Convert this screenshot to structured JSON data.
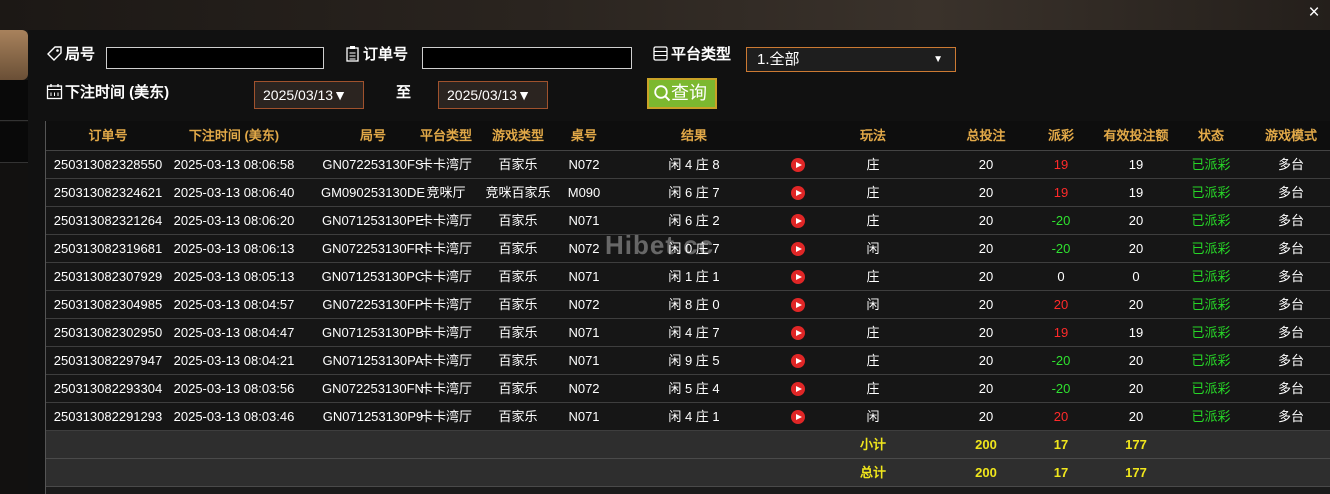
{
  "window": {
    "close_label": "×"
  },
  "filters": {
    "round_label": "局号",
    "round_value": "",
    "order_label": "订单号",
    "order_value": "",
    "platform_label": "平台类型",
    "platform_selected": "1.全部",
    "time_label": "下注时间 (美东)",
    "date_from": "2025/03/13▼",
    "to_label": "至",
    "date_to": "2025/03/13▼",
    "query_label": "查询"
  },
  "table": {
    "headers": [
      "订单号",
      "下注时间 (美东)",
      "局号",
      "平台类型",
      "游戏类型",
      "桌号",
      "结果",
      "",
      "玩法",
      "总投注",
      "派彩",
      "有效投注额",
      "状态",
      "游戏模式"
    ],
    "rows": [
      {
        "order": "250313082328550",
        "time": "2025-03-13 08:06:58",
        "round": "GN072253130FS",
        "platform": "卡卡湾厅",
        "game": "百家乐",
        "table": "N072",
        "result": "闲 4 庄 8",
        "play": "庄",
        "bet": "20",
        "payout": "19",
        "payout_sign": "pos",
        "valid": "19",
        "status": "已派彩",
        "mode": "多台"
      },
      {
        "order": "250313082324621",
        "time": "2025-03-13 08:06:40",
        "round": "GM090253130DE",
        "platform": "竞咪厅",
        "game": "竞咪百家乐",
        "table": "M090",
        "result": "闲 6 庄 7",
        "play": "庄",
        "bet": "20",
        "payout": "19",
        "payout_sign": "pos",
        "valid": "19",
        "status": "已派彩",
        "mode": "多台"
      },
      {
        "order": "250313082321264",
        "time": "2025-03-13 08:06:20",
        "round": "GN071253130PE",
        "platform": "卡卡湾厅",
        "game": "百家乐",
        "table": "N071",
        "result": "闲 6 庄 2",
        "play": "庄",
        "bet": "20",
        "payout": "-20",
        "payout_sign": "neg",
        "valid": "20",
        "status": "已派彩",
        "mode": "多台"
      },
      {
        "order": "250313082319681",
        "time": "2025-03-13 08:06:13",
        "round": "GN072253130FR",
        "platform": "卡卡湾厅",
        "game": "百家乐",
        "table": "N072",
        "result": "闲 0 庄 7",
        "play": "闲",
        "bet": "20",
        "payout": "-20",
        "payout_sign": "neg",
        "valid": "20",
        "status": "已派彩",
        "mode": "多台"
      },
      {
        "order": "250313082307929",
        "time": "2025-03-13 08:05:13",
        "round": "GN071253130PC",
        "platform": "卡卡湾厅",
        "game": "百家乐",
        "table": "N071",
        "result": "闲 1 庄 1",
        "play": "庄",
        "bet": "20",
        "payout": "0",
        "payout_sign": "zero",
        "valid": "0",
        "status": "已派彩",
        "mode": "多台"
      },
      {
        "order": "250313082304985",
        "time": "2025-03-13 08:04:57",
        "round": "GN072253130FP",
        "platform": "卡卡湾厅",
        "game": "百家乐",
        "table": "N072",
        "result": "闲 8 庄 0",
        "play": "闲",
        "bet": "20",
        "payout": "20",
        "payout_sign": "pos",
        "valid": "20",
        "status": "已派彩",
        "mode": "多台"
      },
      {
        "order": "250313082302950",
        "time": "2025-03-13 08:04:47",
        "round": "GN071253130PB",
        "platform": "卡卡湾厅",
        "game": "百家乐",
        "table": "N071",
        "result": "闲 4 庄 7",
        "play": "庄",
        "bet": "20",
        "payout": "19",
        "payout_sign": "pos",
        "valid": "19",
        "status": "已派彩",
        "mode": "多台"
      },
      {
        "order": "250313082297947",
        "time": "2025-03-13 08:04:21",
        "round": "GN071253130PA",
        "platform": "卡卡湾厅",
        "game": "百家乐",
        "table": "N071",
        "result": "闲 9 庄 5",
        "play": "庄",
        "bet": "20",
        "payout": "-20",
        "payout_sign": "neg",
        "valid": "20",
        "status": "已派彩",
        "mode": "多台"
      },
      {
        "order": "250313082293304",
        "time": "2025-03-13 08:03:56",
        "round": "GN072253130FN",
        "platform": "卡卡湾厅",
        "game": "百家乐",
        "table": "N072",
        "result": "闲 5 庄 4",
        "play": "庄",
        "bet": "20",
        "payout": "-20",
        "payout_sign": "neg",
        "valid": "20",
        "status": "已派彩",
        "mode": "多台"
      },
      {
        "order": "250313082291293",
        "time": "2025-03-13 08:03:46",
        "round": "GN071253130P9",
        "platform": "卡卡湾厅",
        "game": "百家乐",
        "table": "N071",
        "result": "闲 4 庄 1",
        "play": "闲",
        "bet": "20",
        "payout": "20",
        "payout_sign": "pos",
        "valid": "20",
        "status": "已派彩",
        "mode": "多台"
      }
    ],
    "subtotal": {
      "label": "小计",
      "bet": "200",
      "payout": "17",
      "valid": "177"
    },
    "total": {
      "label": "总计",
      "bet": "200",
      "payout": "17",
      "valid": "177"
    }
  },
  "watermark": "Hibet.cc",
  "colors": {
    "header_text": "#e2a948",
    "positive": "#ff2a2a",
    "negative": "#2fe12f",
    "status": "#27d627",
    "summary": "#f0e61c",
    "button": "#7cb82f",
    "accent_border": "#cc7a33"
  },
  "icons": [
    "tag-icon",
    "clipboard-icon",
    "list-icon",
    "calendar-icon",
    "search-icon",
    "play-icon",
    "close-icon"
  ]
}
